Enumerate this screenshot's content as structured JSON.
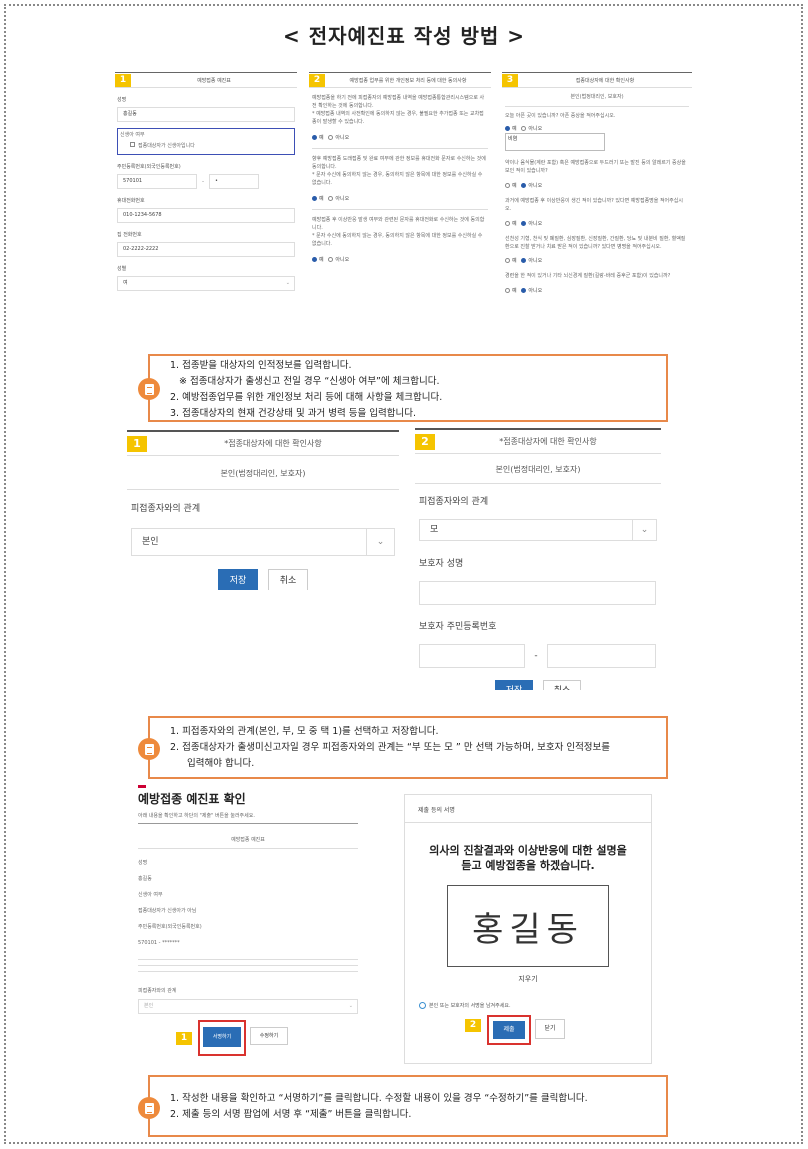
{
  "title": "< 전자예진표 작성 방법 >",
  "s1": {
    "p1": {
      "num": "1",
      "header": "예방접종 예진표",
      "name_label": "성명",
      "name_value": "홍길동",
      "newborn_label": "신생아 여부",
      "newborn_check": "접종대상자가 신생아입니다",
      "rrn_label": "주민등록번호(외국인등록번호)",
      "rrn_front": "570101",
      "rrn_dash": "-",
      "rrn_back": "•",
      "mobile_label": "휴대전화번호",
      "mobile_value": "010-1234-5678",
      "home_label": "집 전화번호",
      "home_value": "02-2222-2222",
      "gender_label": "성별",
      "gender_value": "여"
    },
    "p2": {
      "num": "2",
      "header": "예방접종 업무를 위한 개인정보 처리 등에 대한 동의사항",
      "b1": "예방접종을 하기 전에 피접종자의 예방접종 내역을 예방접종통합관리시스템으로 사전 확인하는 것에 동의합니다.",
      "b1n": "* 예방접종 내역의 사전확인에 동의하지 않는 경우, 불필요한 추가접종 또는 교차접종이 발생할 수 있습니다.",
      "b2": "향후 예방접종 도래접종 및 완료 여부에 관한 정보를 휴대전화 문자로 수신하는 것에 동의합니다.",
      "b2n": "* 문자 수신에 동의하지 않는 경우, 동의하지 않은 항목에 대한 정보를 수신하실 수 없습니다.",
      "b3": "예방접종 후 이상반응 발생 여부와 관련된 문자를 휴대전화로 수신하는 것에 동의합니다.",
      "b3n": "* 문자 수신에 동의하지 않는 경우, 동의하지 않은 항목에 대한 정보를 수신하실 수 없습니다.",
      "yes": "예",
      "no": "아니오"
    },
    "p3": {
      "num": "3",
      "header": "접종대상자에 대한 확인사항",
      "sub": "본인(법정대리인, 보호자)",
      "q1": "오늘 아픈 곳이 있습니까? 아픈 증상을 적어주십시오.",
      "q1_text": "비염",
      "q2": "약이나 음식물(계란 포함) 혹은 예방접종으로 두드러기 또는 발진 등의 알레르기 증상을 보인 적이 있습니까?",
      "q3": "과거에 예방접종 후 이상반응이 생긴 적이 있습니까? 있다면 예방접종명을 적어주십시오.",
      "q4": "선천성 기형, 천식 및 폐질환, 심장질환, 신장질환, 간질환, 당뇨 및 내분비 질환, 혈액질환으로 진찰 받거나 치료 받은 적이 있습니까? 있다면 병명을 적어주십시오.",
      "q5": "경련을 한 적이 있거나 기타 뇌신경계 질환(길랑-바레 증후군 포함)이 있습니까?",
      "yes": "예",
      "no": "아니오"
    }
  },
  "note1": [
    "1. 접종받을 대상자의 인적정보를 입력합니다.",
    "※ 접종대상자가 출생신고 전일 경우 “신생아 여부”에 체크합니다.",
    "2. 예방접종업무를 위한 개인정보 처리 등에 대해 사항을 체크합니다.",
    "3. 접종대상자의 현재 건강상태 및 과거 병력 등을 입력합니다."
  ],
  "s2": {
    "p1": {
      "num": "1",
      "header": "*접종대상자에 대한 확인사항",
      "sub": "본인(법정대리인, 보호자)",
      "rel_label": "피접종자와의 관계",
      "rel_value": "본인",
      "save": "저장",
      "cancel": "취소"
    },
    "p2": {
      "num": "2",
      "header": "*접종대상자에 대한 확인사항",
      "sub": "본인(법정대리인, 보호자)",
      "rel_label": "피접종자와의 관계",
      "rel_value": "모",
      "guardian_name_label": "보호자 성명",
      "guardian_rrn_label": "보호자 주민등록번호",
      "dash": "-",
      "save": "저장",
      "cancel": "취소"
    }
  },
  "note2": [
    "1.   피접종자와의 관계(본인, 부, 모 중 택 1)를 선택하고 저장합니다.",
    "2.   접종대상자가 출생미신고자일 경우 피접종자와의 관계는 “부 또는 모 ” 만 선택 가능하며, 보호자 인적정보를",
    "입력해야 합니다."
  ],
  "s3": {
    "left": {
      "title": "예방접종 예진표 확인",
      "desc": "아래 내용을 확인하고 하단의 \"제출\" 버튼을 눌러주세요.",
      "header": "예방접종 예진표",
      "name_label": "성명",
      "name_value": "홍길동",
      "newborn_label": "신생아 여부",
      "newborn_value": "접종대상자가 신생아가 아님",
      "rrn_label": "주민등록번호(외국인등록번호)",
      "rrn_value": "570101 - *******",
      "rel_label": "피접종자와의 관계",
      "rel_value": "본인",
      "num": "1",
      "sign_btn": "서명하기",
      "edit_btn": "수정하기"
    },
    "right": {
      "header": "제출 등의 서명",
      "line1": "의사의 진찰결과와 이상반응에 대한 설명을",
      "line2": "듣고 예방접종을 하겠습니다.",
      "signature": "홍길동",
      "erase": "지우기",
      "hint": "본인 또는 보호자의 서명을 남겨주세요.",
      "num": "2",
      "submit": "제출",
      "close": "닫기"
    }
  },
  "note3": [
    "1.   작성한 내용을 확인하고 “서명하기”를 클릭합니다. 수정할 내용이 있을 경우 “수정하기”를 클릭합니다.",
    "2.   제출 등의 서명 팝업에 서명 후 “제출” 버튼을 클릭합니다."
  ]
}
